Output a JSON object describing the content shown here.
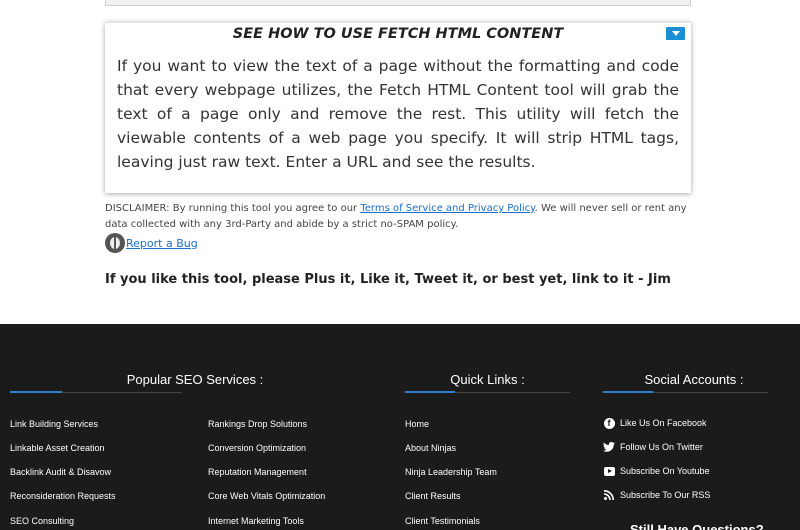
{
  "howto": {
    "title": "SEE HOW TO USE FETCH HTML CONTENT",
    "text": "If you want to view the text of a page without the formatting and code that every webpage utilizes, the Fetch HTML Content tool will grab the text of a page only and remove the rest. This utility will fetch the viewable contents of a web page you specify. It will strip HTML tags, leaving just raw text. Enter a URL and see the results.",
    "toggle_icon": "chevron-down-icon"
  },
  "disclaimer": {
    "prefix": "DISCLAIMER: By running this tool you agree to our ",
    "link": "Terms of Service and Privacy Policy",
    "suffix": ". We will never sell or rent any data collected with any 3rd-Party and abide by a strict no-SPAM policy."
  },
  "report_bug": "Report a Bug",
  "plus_message": "If you like this tool, please Plus it, Like it, Tweet it, or best yet, link to it - Jim",
  "footer": {
    "popular_title": "Popular SEO Services :",
    "popular_col1": [
      "Link Building Services",
      "Linkable Asset Creation",
      "Backlink Audit & Disavow",
      "Reconsideration Requests",
      "SEO Consulting"
    ],
    "popular_col2": [
      "Rankings Drop Solutions",
      "Conversion Optimization",
      "Reputation Management",
      "Core Web Vitals Optimization",
      "Internet Marketing Tools"
    ],
    "quick_title": "Quick Links :",
    "quick_links": [
      "Home",
      "About Ninjas",
      "Ninja Leadership Team",
      "Client Results",
      "Client Testimonials"
    ],
    "social_title": "Social Accounts :",
    "social_links": [
      {
        "label": "Like Us On Facebook",
        "icon": "facebook-icon"
      },
      {
        "label": "Follow Us On Twitter",
        "icon": "twitter-icon"
      },
      {
        "label": "Subscribe On Youtube",
        "icon": "youtube-icon"
      },
      {
        "label": "Subscribe To Our RSS",
        "icon": "rss-icon"
      }
    ],
    "cut_heading": "Still Have Questions?"
  },
  "colors": {
    "accent": "#2f7fd1",
    "footer_bg": "#1b1b1b",
    "link": "#1a6fd1"
  }
}
